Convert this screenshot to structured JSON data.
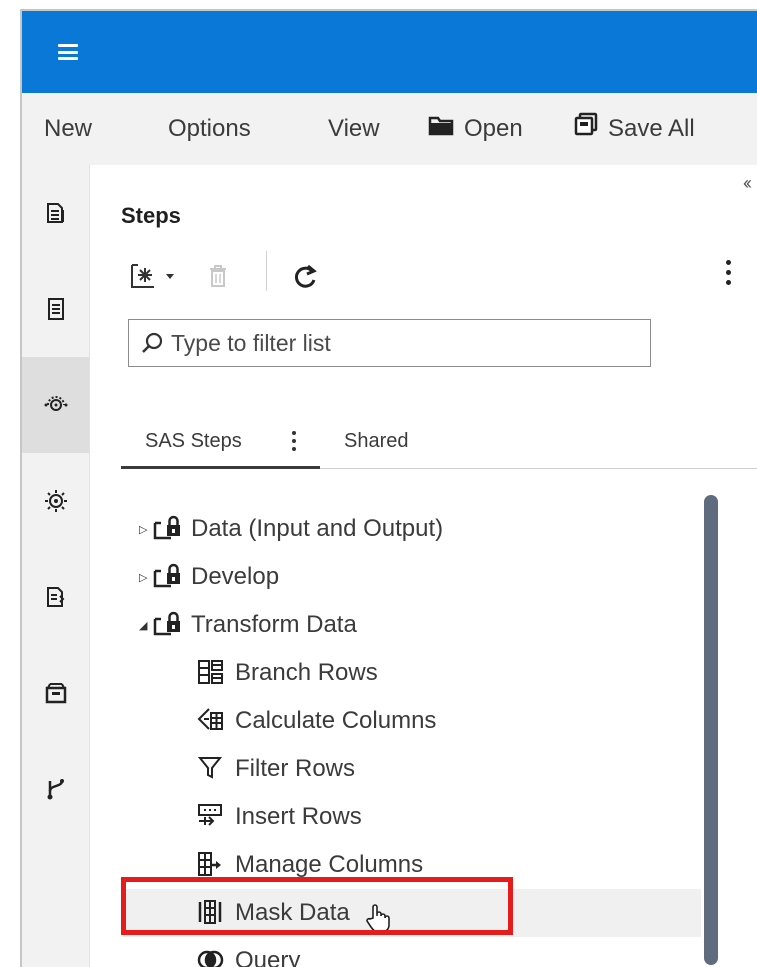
{
  "menubar": {
    "new": "New",
    "options": "Options",
    "view": "View",
    "open": "Open",
    "save_all": "Save All"
  },
  "steps": {
    "title": "Steps",
    "filter_placeholder": "Type to filter list",
    "tabs": [
      {
        "label": "SAS Steps",
        "active": true
      },
      {
        "label": "Shared",
        "active": false
      }
    ],
    "tree": [
      {
        "label": "Data (Input and Output)",
        "type": "group",
        "expanded": false,
        "icon": "folder-lock-icon"
      },
      {
        "label": "Develop",
        "type": "group",
        "expanded": false,
        "icon": "folder-lock-icon"
      },
      {
        "label": "Transform Data",
        "type": "group",
        "expanded": true,
        "icon": "folder-lock-icon"
      },
      {
        "label": "Branch Rows",
        "type": "step",
        "icon": "branch-rows-icon"
      },
      {
        "label": "Calculate Columns",
        "type": "step",
        "icon": "calculate-columns-icon"
      },
      {
        "label": "Filter Rows",
        "type": "step",
        "icon": "filter-icon"
      },
      {
        "label": "Insert Rows",
        "type": "step",
        "icon": "insert-rows-icon"
      },
      {
        "label": "Manage Columns",
        "type": "step",
        "icon": "manage-columns-icon"
      },
      {
        "label": "Mask Data",
        "type": "step",
        "icon": "mask-data-icon",
        "hovered": true
      },
      {
        "label": "Query",
        "type": "step",
        "icon": "query-icon"
      }
    ]
  },
  "colors": {
    "titlebar": "#0a78d7",
    "highlight": "#e51c1c",
    "scrollbar": "#5f6b7e"
  }
}
